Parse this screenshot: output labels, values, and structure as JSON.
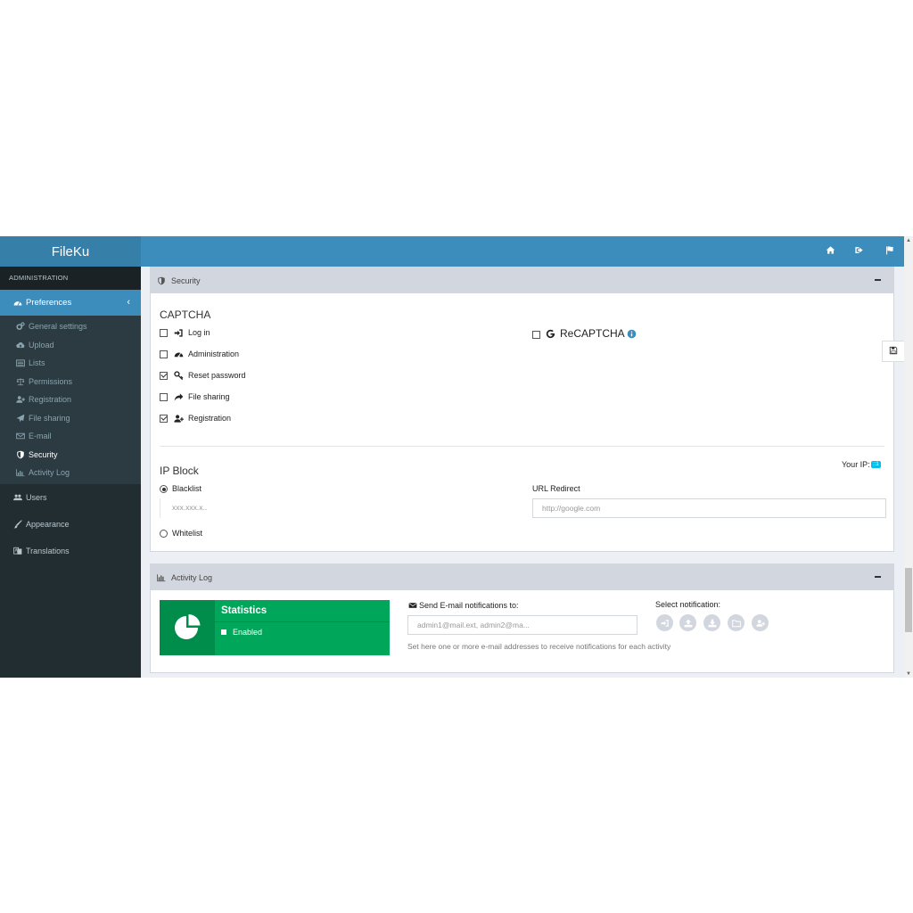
{
  "app": {
    "title": "FileKu"
  },
  "sidebar": {
    "header": "ADMINISTRATION",
    "active": {
      "label": "Preferences"
    },
    "sub_items": [
      {
        "label": "General settings",
        "icon": "cogs-icon"
      },
      {
        "label": "Upload",
        "icon": "cloud-upload-icon"
      },
      {
        "label": "Lists",
        "icon": "list-icon"
      },
      {
        "label": "Permissions",
        "icon": "balance-icon"
      },
      {
        "label": "Registration",
        "icon": "user-plus-icon"
      },
      {
        "label": "File sharing",
        "icon": "paper-plane-icon"
      },
      {
        "label": "E-mail",
        "icon": "envelope-icon"
      },
      {
        "label": "Security",
        "icon": "shield-icon"
      },
      {
        "label": "Activity Log",
        "icon": "bar-chart-icon"
      }
    ],
    "main_items": [
      {
        "label": "Users",
        "icon": "users-icon"
      },
      {
        "label": "Appearance",
        "icon": "brush-icon"
      },
      {
        "label": "Translations",
        "icon": "translate-icon"
      }
    ]
  },
  "security": {
    "title": "Security",
    "captcha": {
      "title": "CAPTCHA",
      "options": [
        {
          "label": "Log in",
          "checked": false
        },
        {
          "label": "Administration",
          "checked": false
        },
        {
          "label": "Reset password",
          "checked": true
        },
        {
          "label": "File sharing",
          "checked": false
        },
        {
          "label": "Registration",
          "checked": true
        }
      ],
      "recaptcha": {
        "label": "ReCAPTCHA",
        "checked": false
      }
    },
    "ip_block": {
      "title": "IP Block",
      "your_ip_label": "Your IP:",
      "your_ip_value": "::1",
      "blacklist_label": "Blacklist",
      "blacklist_placeholder": "xxx.xxx.x..",
      "whitelist_label": "Whitelist",
      "selected": "Blacklist",
      "url_redirect_label": "URL Redirect",
      "url_redirect_placeholder": "http://google.com"
    }
  },
  "activity_log": {
    "title": "Activity Log",
    "stat": {
      "title": "Statistics",
      "status": "Enabled"
    },
    "email": {
      "label": "Send E-mail notifications to:",
      "placeholder": "admin1@mail.ext, admin2@ma...",
      "help": "Set here one or more e-mail addresses to receive notifications for each activity"
    },
    "select_label": "Select notification:",
    "notification_icons": [
      "login-icon",
      "upload-icon",
      "download-icon",
      "folder-icon",
      "user-plus-icon"
    ]
  },
  "colors": {
    "header": "#3c8dbc",
    "brand": "#367fa9",
    "sidebar": "#222d32",
    "success": "#00a65a"
  }
}
